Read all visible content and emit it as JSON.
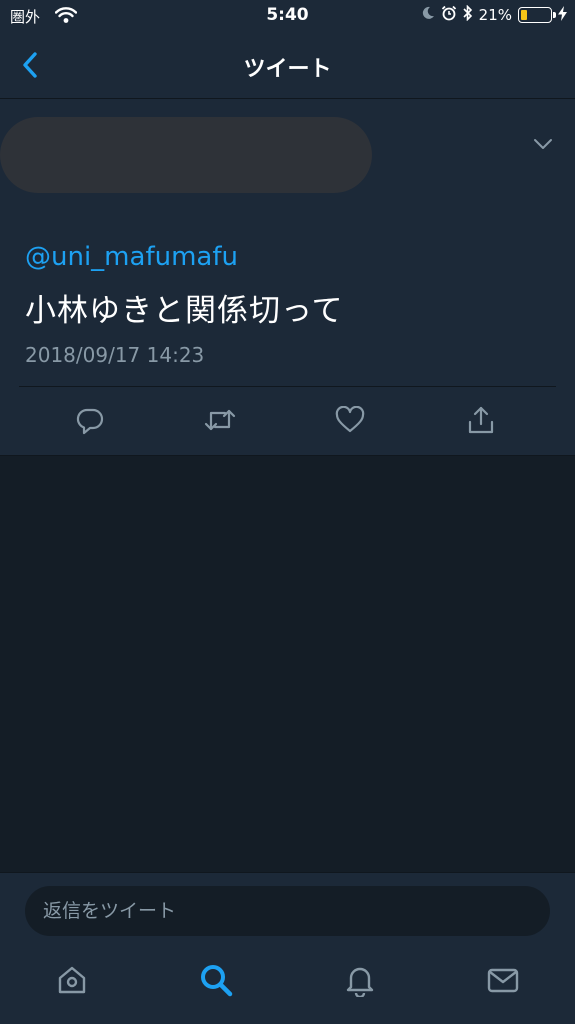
{
  "status_bar": {
    "carrier": "圏外",
    "time": "5:40",
    "battery_percent_text": "21%",
    "battery_level": 0.21,
    "icons": [
      "wifi-icon",
      "moon-icon",
      "alarm-icon",
      "bluetooth-icon",
      "battery-icon",
      "charging-icon"
    ]
  },
  "nav": {
    "title": "ツイート",
    "back_icon": "chevron-left-icon"
  },
  "tweet": {
    "mention": "@uni_mafumafu",
    "text": "小林ゆきと関係切って",
    "timestamp": "2018/09/17 14:23",
    "menu_icon": "chevron-down-icon",
    "actions": [
      "reply-icon",
      "retweet-icon",
      "like-icon",
      "share-icon"
    ]
  },
  "reply": {
    "placeholder": "返信をツイート"
  },
  "tabs": [
    {
      "name": "home",
      "icon": "home-icon",
      "active": false
    },
    {
      "name": "search",
      "icon": "search-icon",
      "active": true
    },
    {
      "name": "notifications",
      "icon": "bell-icon",
      "active": false
    },
    {
      "name": "messages",
      "icon": "mail-icon",
      "active": false
    }
  ],
  "colors": {
    "background": "#141d26",
    "surface": "#1c2938",
    "accent": "#1da1f2",
    "secondary_text": "#8899a6"
  }
}
